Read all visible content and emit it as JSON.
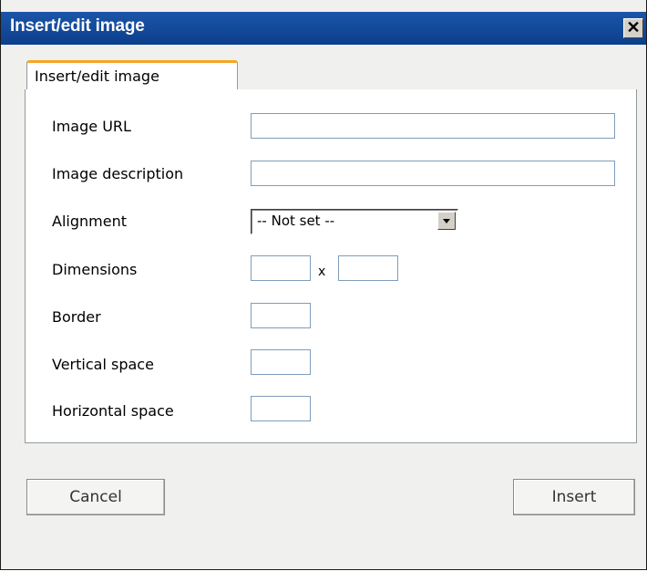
{
  "dialog": {
    "title": "Insert/edit image",
    "close_glyph": "✕",
    "close_icon": "close-icon"
  },
  "tabs": [
    {
      "label": "Insert/edit image",
      "active": true
    }
  ],
  "form": {
    "image_url": {
      "label": "Image URL",
      "value": ""
    },
    "image_description": {
      "label": "Image description",
      "value": ""
    },
    "alignment": {
      "label": "Alignment",
      "selected": "-- Not set --"
    },
    "dimensions": {
      "label": "Dimensions",
      "width": "",
      "height": "",
      "separator": "x"
    },
    "border": {
      "label": "Border",
      "value": ""
    },
    "vertical_space": {
      "label": "Vertical space",
      "value": ""
    },
    "horizontal_space": {
      "label": "Horizontal space",
      "value": ""
    }
  },
  "buttons": {
    "cancel": "Cancel",
    "insert": "Insert"
  },
  "colors": {
    "titlebar": "#0c3f8c",
    "tab_accent": "#f5a623",
    "dialog_bg": "#f0f0ee"
  }
}
